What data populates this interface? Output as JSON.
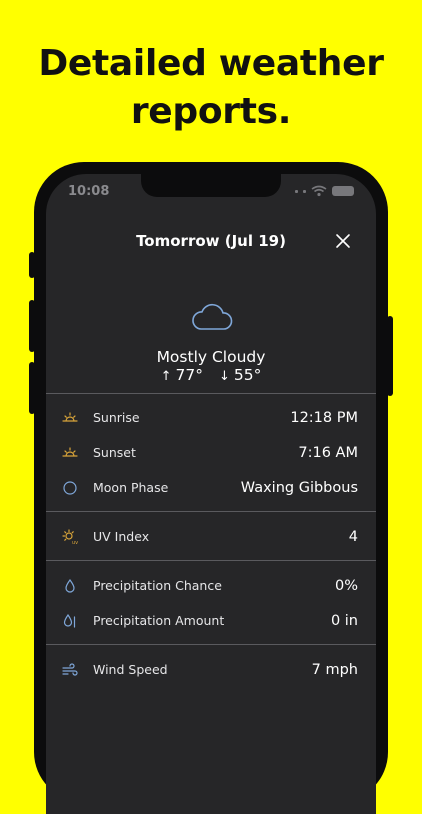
{
  "headline": {
    "line1": "Detailed weather",
    "line2": "reports."
  },
  "status_bar": {
    "time": "10:08"
  },
  "header": {
    "title": "Tomorrow (Jul 19)",
    "close_icon": "close-icon"
  },
  "summary": {
    "icon": "cloud-icon",
    "condition": "Mostly Cloudy",
    "high_arrow": "↑",
    "high": "77°",
    "low_arrow": "↓",
    "low": "55°"
  },
  "details": {
    "sunrise": {
      "icon": "sunrise-icon",
      "label": "Sunrise",
      "value": "12:18 PM"
    },
    "sunset": {
      "icon": "sunset-icon",
      "label": "Sunset",
      "value": "7:16 AM"
    },
    "moon_phase": {
      "icon": "moon-phase-icon",
      "label": "Moon Phase",
      "value": "Waxing Gibbous"
    },
    "uv_index": {
      "icon": "uv-index-icon",
      "label": "UV Index",
      "value": "4"
    },
    "precip_chance": {
      "icon": "raindrop-icon",
      "label": "Precipitation Chance",
      "value": "0%"
    },
    "precip_amount": {
      "icon": "rain-gauge-icon",
      "label": "Precipitation Amount",
      "value": "0 in"
    },
    "wind_speed": {
      "icon": "wind-icon",
      "label": "Wind Speed",
      "value": "7 mph"
    }
  },
  "colors": {
    "background": "#FFFF00",
    "screen": "#262628",
    "icon_accent": "#D9A53A",
    "icon_blue": "#7FA7D9"
  }
}
